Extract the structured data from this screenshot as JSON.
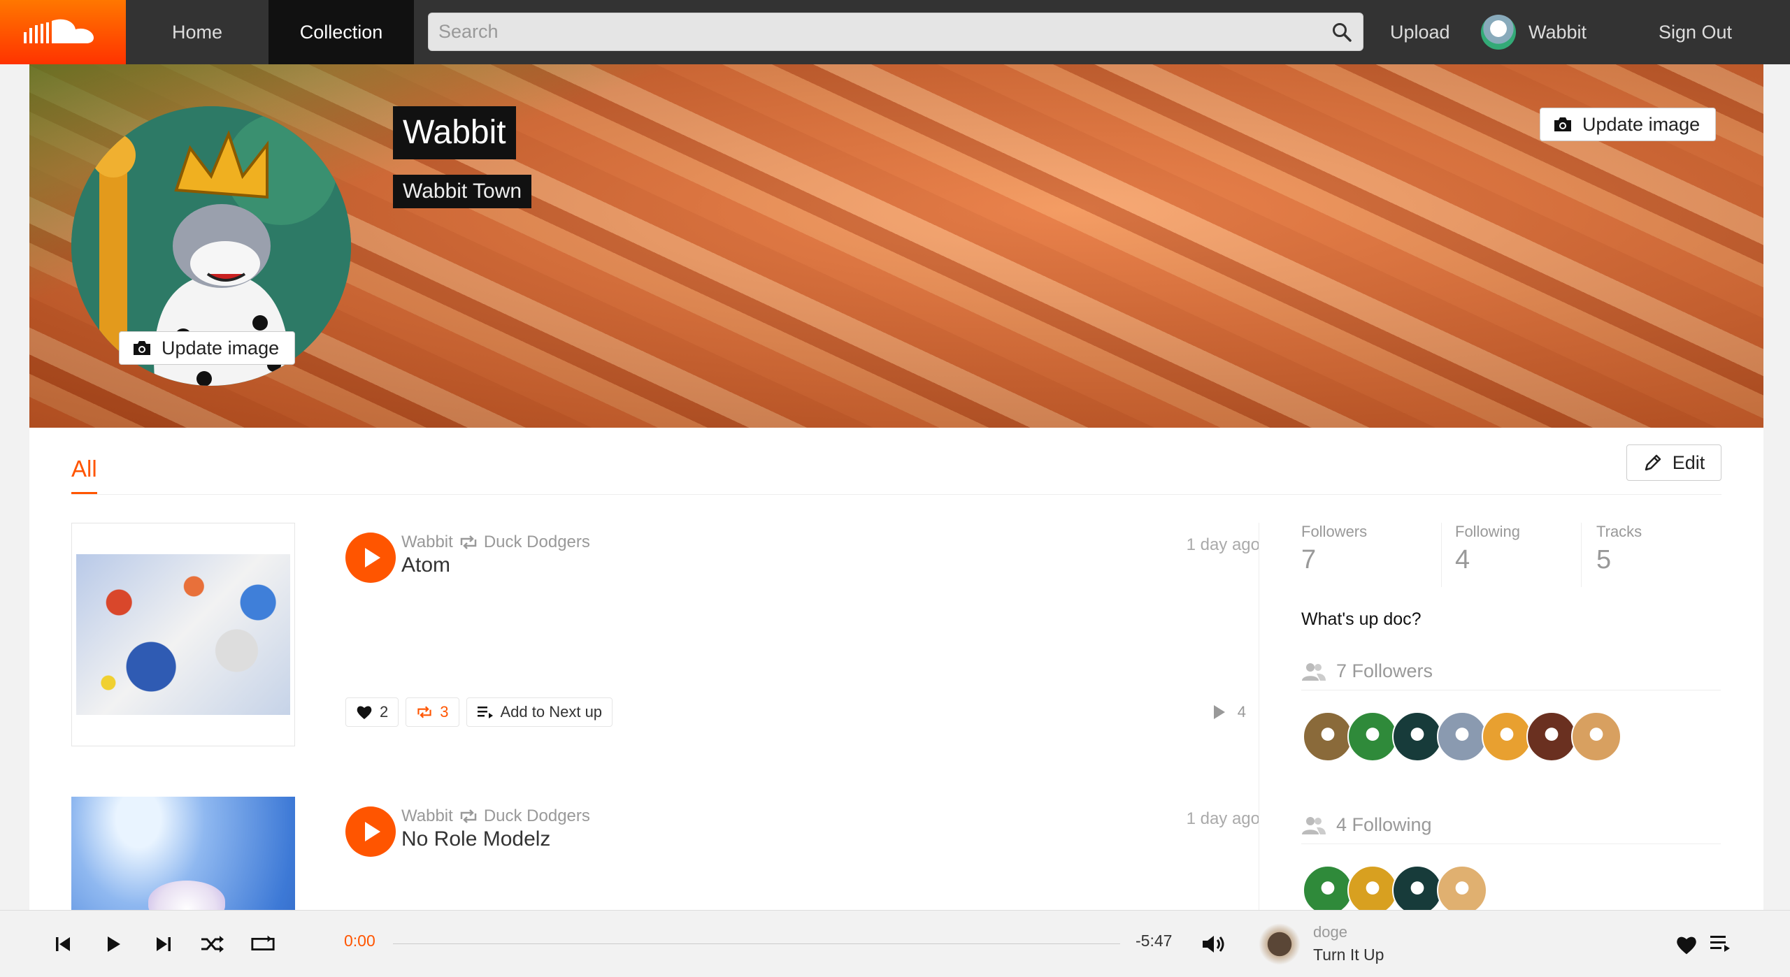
{
  "nav": {
    "home": "Home",
    "collection": "Collection",
    "search_placeholder": "Search",
    "upload": "Upload",
    "username": "Wabbit",
    "signout": "Sign Out"
  },
  "hero": {
    "name": "Wabbit",
    "city": "Wabbit Town",
    "update_cover_label": "Update image",
    "update_avatar_label": "Update image"
  },
  "profile_tabs": {
    "active": "All",
    "edit_label": "Edit"
  },
  "tracks": [
    {
      "uploader": "Wabbit",
      "reposter": "Duck Dodgers",
      "title": "Atom",
      "time": "1 day ago",
      "likes": "2",
      "reposts": "3",
      "next_up_label": "Add to Next up",
      "plays": "4"
    },
    {
      "uploader": "Wabbit",
      "reposter": "Duck Dodgers",
      "title": "No Role Modelz",
      "time": "1 day ago"
    }
  ],
  "stats": [
    {
      "label": "Followers",
      "value": "7"
    },
    {
      "label": "Following",
      "value": "4"
    },
    {
      "label": "Tracks",
      "value": "5"
    }
  ],
  "bio": "What's up doc?",
  "followers_heading": "7 Followers",
  "following_heading": "4 Following",
  "follower_avatar_colors": [
    "#8a6a3a",
    "#2f8a3a",
    "#173b3a",
    "#8a9ab0",
    "#e8a030",
    "#6a3020",
    "#d8a060"
  ],
  "following_avatar_colors": [
    "#2f8a3a",
    "#d8a020",
    "#173b3a",
    "#e0b070"
  ],
  "player": {
    "current_time": "0:00",
    "remaining_time": "-5:47",
    "progress": 0,
    "artist": "doge",
    "title": "Turn It Up"
  },
  "colors": {
    "accent": "#ff5500",
    "nav_bg": "#333333"
  }
}
